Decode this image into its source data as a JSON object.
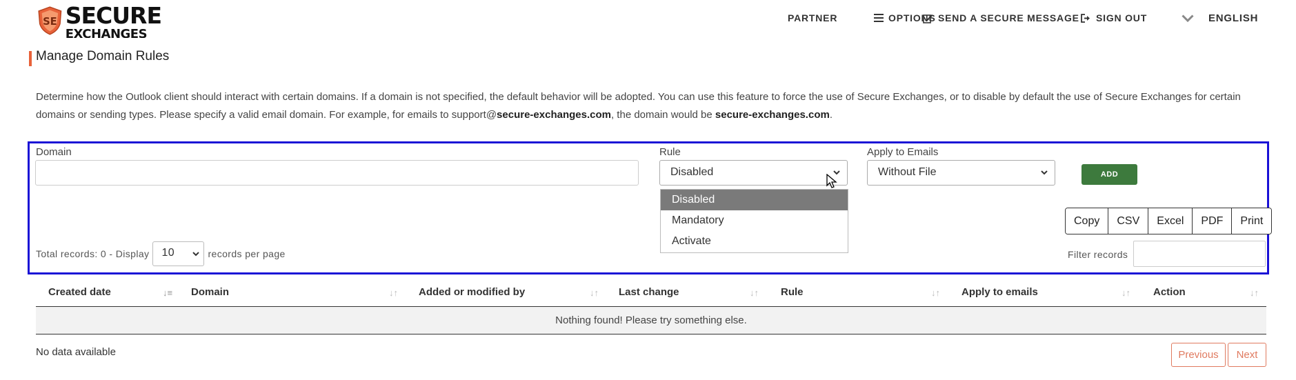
{
  "brand": {
    "line1": "SECURE",
    "line2": "EXCHANGES",
    "accent": "#e8623a"
  },
  "nav": {
    "partner": "PARTNER",
    "options": "OPTIONS",
    "send": "SEND A SECURE MESSAGE",
    "signout": "SIGN OUT",
    "language": "ENGLISH"
  },
  "page": {
    "title": "Manage Domain Rules",
    "desc_part1": "Determine how the Outlook client should interact with certain domains. If a domain is not specified, the default behavior will be adopted. You can use this feature to force the use of Secure Exchanges, or to disable by default the use of Secure Exchanges for certain domains or sending types. Please specify a valid email domain. For example, for emails to support@",
    "desc_bold1": "secure-exchanges.com",
    "desc_part2": ", the domain would be ",
    "desc_bold2": "secure-exchanges.com",
    "desc_part3": "."
  },
  "form": {
    "domain_label": "Domain",
    "domain_value": "",
    "rule_label": "Rule",
    "rule_value": "Disabled",
    "rule_options": [
      "Disabled",
      "Mandatory",
      "Activate"
    ],
    "apply_label": "Apply to Emails",
    "apply_value": "Without File",
    "add_label": "ADD"
  },
  "exports": [
    "Copy",
    "CSV",
    "Excel",
    "PDF",
    "Print"
  ],
  "records": {
    "total_text": "Total records: 0 - Display",
    "per_page_value": "10",
    "per_page_suffix": "records per page",
    "filter_label": "Filter records",
    "filter_value": ""
  },
  "table": {
    "columns": [
      "Created date",
      "Domain",
      "Added or modified by",
      "Last change",
      "Rule",
      "Apply to emails",
      "Action"
    ],
    "empty_message": "Nothing found! Please try something else.",
    "no_data": "No data available",
    "previous": "Previous",
    "next": "Next"
  },
  "colors": {
    "highlight": "#1a10d6",
    "add_button": "#3d7a3d",
    "pager": "#e07a5f"
  }
}
